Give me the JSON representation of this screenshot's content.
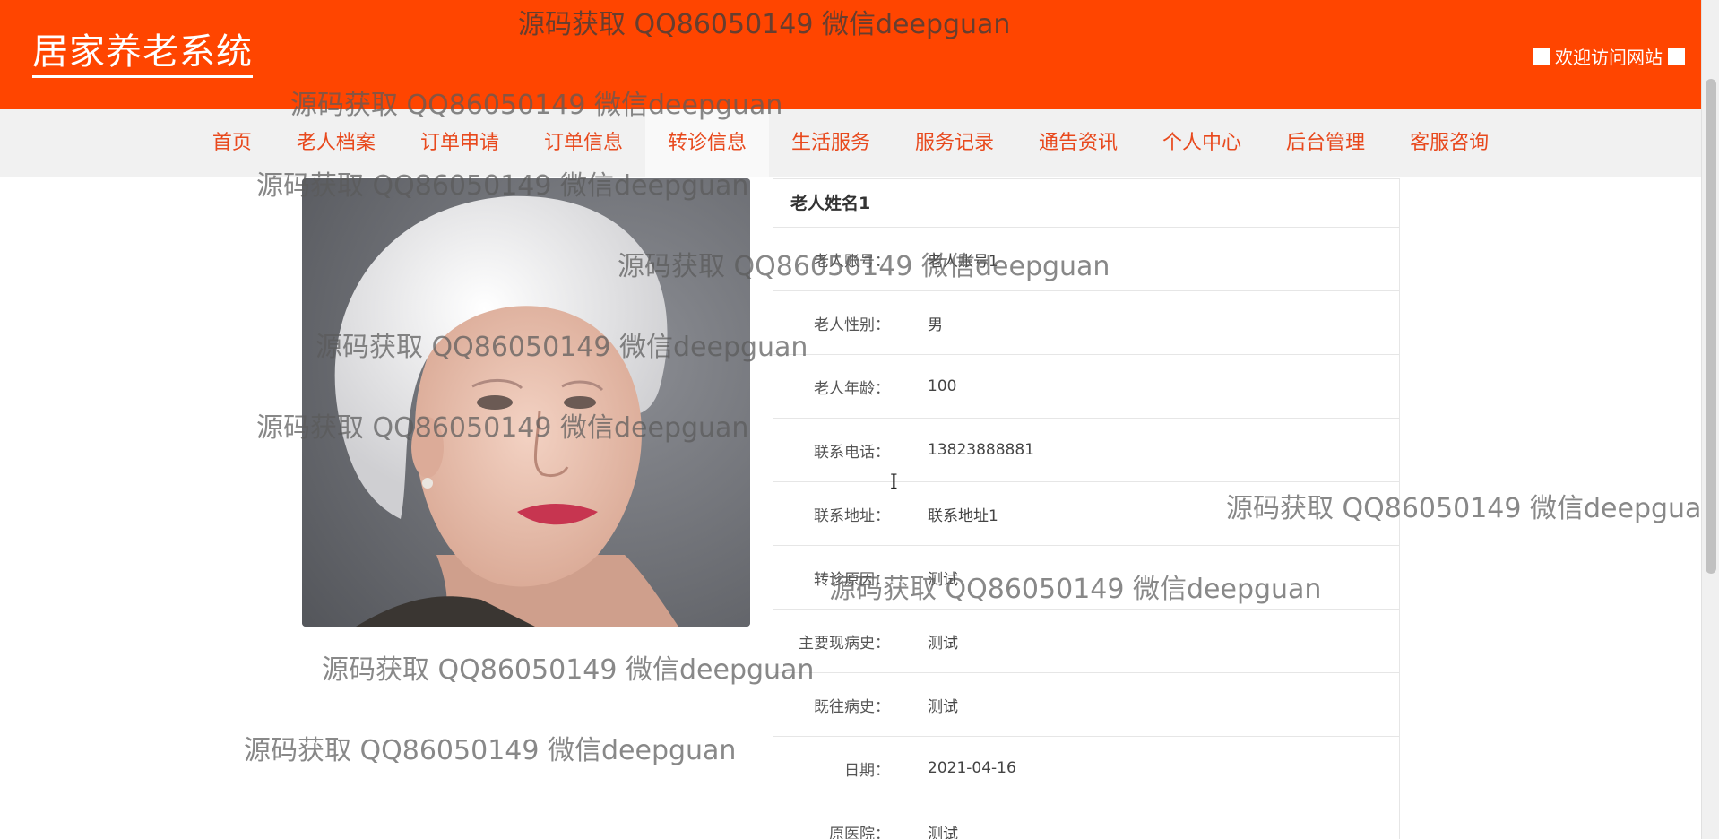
{
  "header": {
    "logo": "居家养老系统",
    "welcome": "欢迎访问网站"
  },
  "nav": {
    "items": [
      "首页",
      "老人档案",
      "订单申请",
      "订单信息",
      "转诊信息",
      "生活服务",
      "服务记录",
      "通告资讯",
      "个人中心",
      "后台管理",
      "客服咨询"
    ],
    "active": "转诊信息"
  },
  "photo": {
    "alt": "elderly woman photo"
  },
  "detail": {
    "title": "老人姓名1",
    "rows": [
      {
        "label": "老人账号：",
        "value": "老人账号1"
      },
      {
        "label": "老人性别：",
        "value": "男"
      },
      {
        "label": "老人年龄：",
        "value": "100"
      },
      {
        "label": "联系电话：",
        "value": "13823888881"
      },
      {
        "label": "联系地址：",
        "value": "联系地址1"
      },
      {
        "label": "转诊原因：",
        "value": "测试"
      },
      {
        "label": "主要现病史：",
        "value": "测试"
      },
      {
        "label": "既往病史：",
        "value": "测试"
      },
      {
        "label": "日期：",
        "value": "2021-04-16"
      },
      {
        "label": "原医院：",
        "value": "测试"
      }
    ]
  },
  "watermark": "源码获取 QQ86050149 微信deepguan",
  "colors": {
    "brand": "#ff4500",
    "nav_bg": "#f1f1f1",
    "nav_text": "#e8491d"
  }
}
